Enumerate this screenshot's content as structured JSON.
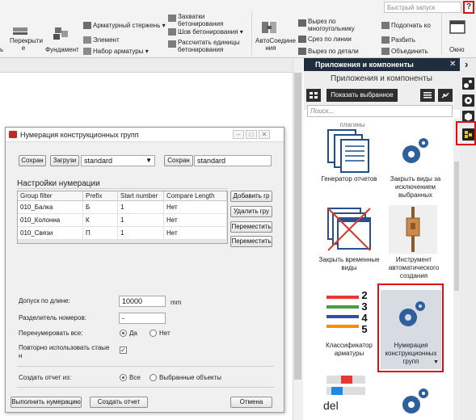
{
  "ribbon": {
    "rebar_label": "Арматурный стержень",
    "element_label": "Элемент",
    "rebar_set_label": "Набор арматуры",
    "floors_label": "Перекрыти е",
    "foundation_label": "Фундамент",
    "grips_label": "Захватки бетонирования",
    "pour_joint_label": "Шов бетонирования",
    "calc_units_label": "Рассчитать единицы бетонирования",
    "auto_connect_label": "АвтоСоедине ния",
    "cut_multi_label": "Вырез по многоугольнику",
    "cut_line_label": "Срез по линии",
    "cut_part_label": "Вырез по детали",
    "fit_label": "Подогнать ко",
    "split_label": "Разбить",
    "merge_label": "Объединить",
    "window_label": "Окно",
    "search_placeholder": "Быстрый запуск",
    "help_glyph": "?",
    "left_edge_label": "ь"
  },
  "dialog": {
    "title": "Нумерация конструкционных групп",
    "save_btn_1": "Сохран",
    "load_btn": "Загрузи",
    "preset_value": "standard",
    "save_btn_2": "Сохран",
    "preset_name_value": "standard",
    "section_title": "Настройки нумерации",
    "columns": [
      "Group filter",
      "Prefix",
      "Start number",
      "Compare Length"
    ],
    "rows": [
      {
        "filter": "010_Балка",
        "prefix": "Б",
        "start": "1",
        "compare": "Нет"
      },
      {
        "filter": "010_Колонна",
        "prefix": "К",
        "start": "1",
        "compare": "Нет"
      },
      {
        "filter": "010_Связи",
        "prefix": "П",
        "start": "1",
        "compare": "Нет"
      }
    ],
    "add_btn": "Добавить гр",
    "delete_btn": "Удалить гру",
    "move_btn_1": "Переместить",
    "move_btn_2": "Переместить",
    "tolerance_label": "Допуск по длине:",
    "tolerance_value": "10000",
    "tolerance_unit": "mm",
    "separator_label": "Разделитель номеров:",
    "separator_value": "-",
    "renumber_label": "Перенумеровать все:",
    "renumber_yes": "Да",
    "renumber_no": "Нет",
    "reuse_label": "Повторно использовать стаые н",
    "reuse_checked": true,
    "report_label": "Создать отчет из:",
    "report_all": "Все",
    "report_selected": "Выбранные объекты",
    "run_btn": "Выполнить нумерацию",
    "report_btn": "Создать отчет",
    "cancel_btn": "Отмена",
    "min_glyph": "–",
    "max_glyph": "□",
    "close_glyph": "✕"
  },
  "panel": {
    "header": "Приложения и компоненты",
    "close_glyph": "✕",
    "subtitle": "Приложения и компоненты",
    "show_selected_btn": "Показать выбранное",
    "search_placeholder": "Поиск...",
    "partial_top_label": "Показать все плагины",
    "tiles": [
      {
        "label": "Генератор отчетов"
      },
      {
        "label": "Закрыть виды за исключением выбранных"
      },
      {
        "label": "Закрыть временные виды"
      },
      {
        "label": "Инструмент автоматического создания"
      },
      {
        "label": "Классификатор арматуры"
      },
      {
        "label": "Нумерация конструкционных групп"
      },
      {
        "label": "del"
      }
    ],
    "rebar_numbers": [
      "2",
      "3",
      "4",
      "5"
    ],
    "collapse_glyph": "›"
  },
  "colors": {
    "highlight": "#e01010",
    "panel_header": "#1f2d3d",
    "gear_blue": "#2f5f9e"
  }
}
